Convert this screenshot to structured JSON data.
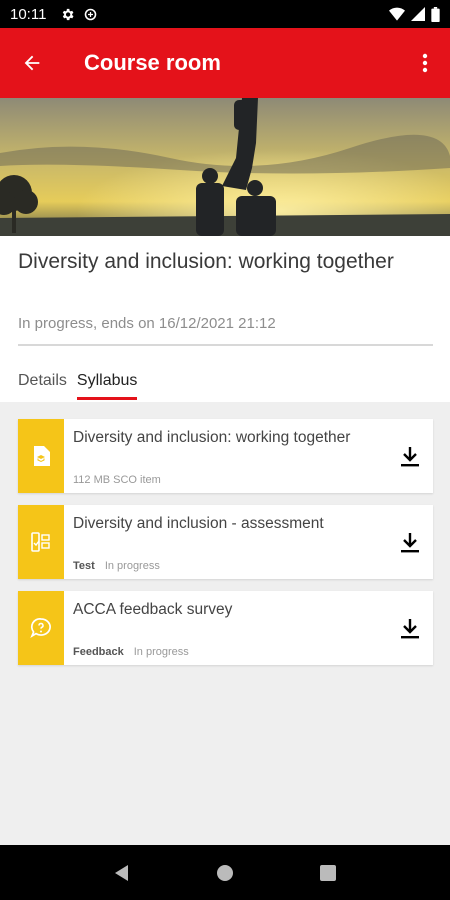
{
  "status_bar": {
    "time": "10:11"
  },
  "app_bar": {
    "title": "Course room",
    "back_icon": "arrow-left-icon",
    "menu_icon": "more-vert-icon"
  },
  "course": {
    "title": "Diversity and inclusion: working together",
    "status": "In progress, ends on 16/12/2021 21:12"
  },
  "tabs": [
    {
      "label": "Details",
      "active": false
    },
    {
      "label": "Syllabus",
      "active": true
    }
  ],
  "items": [
    {
      "title": "Diversity and inclusion: working together",
      "type": "",
      "meta": "112 MB SCO item",
      "icon": "sco-package-icon"
    },
    {
      "title": "Diversity and inclusion - assessment",
      "type": "Test",
      "meta": "In progress",
      "icon": "test-checklist-icon"
    },
    {
      "title": "ACCA feedback survey",
      "type": "Feedback",
      "meta": "In progress",
      "icon": "feedback-bubble-icon"
    }
  ],
  "colors": {
    "accent": "#e4121a",
    "item_icon_bg": "#f5c518"
  }
}
